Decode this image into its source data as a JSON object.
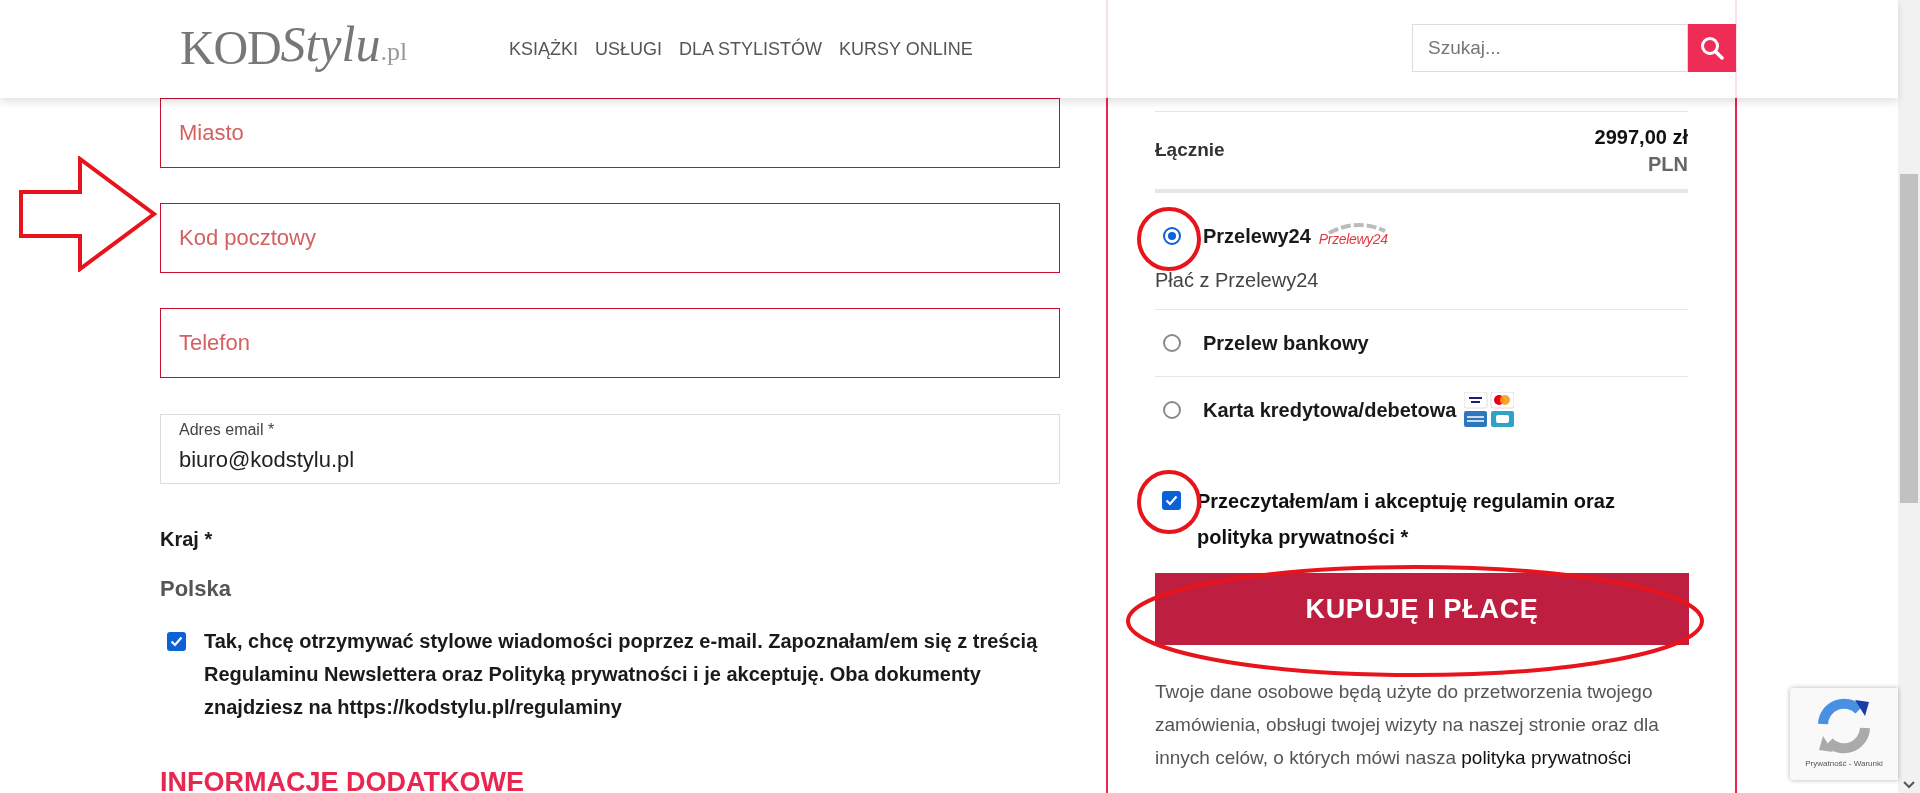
{
  "header": {
    "logo": {
      "main": "KOD",
      "script": "Stylu",
      "suffix": ".pl"
    },
    "nav": [
      "KSIĄŻKI",
      "USŁUGI",
      "DLA STYLISTÓW",
      "KURSY ONLINE"
    ],
    "search": {
      "placeholder": "Szukaj..."
    }
  },
  "form": {
    "fields": [
      {
        "placeholder": "Miasto",
        "invalid": true
      },
      {
        "placeholder": "Kod pocztowy",
        "invalid": true
      },
      {
        "placeholder": "Telefon",
        "invalid": true
      },
      {
        "label": "Adres email *",
        "value": "biuro@kodstylu.pl",
        "invalid": false
      }
    ],
    "country_label": "Kraj *",
    "country_value": "Polska",
    "newsletter": {
      "checked": true,
      "text": "Tak, chcę otrzymywać stylowe wiadomości poprzez e-mail. Zapoznałam/em się z treścią Regulaminu Newslettera oraz Polityką prywatności i je akceptuję. Oba dokumenty znajdziesz na https://kodstylu.pl/regulaminy"
    },
    "section_heading": "INFORMACJE DODATKOWE"
  },
  "order": {
    "total": {
      "label": "Łącznie",
      "value": "2997,00 zł",
      "currency": "PLN"
    },
    "payment_methods": [
      {
        "label": "Przelewy24",
        "selected": true,
        "kind": "p24",
        "logo": "Przelewy24",
        "description": "Płać z Przelewy24"
      },
      {
        "label": "Przelew bankowy",
        "selected": false,
        "kind": "plain"
      },
      {
        "label": "Karta kredytowa/debetowa",
        "selected": false,
        "kind": "cards"
      }
    ],
    "terms": {
      "checked": true,
      "text": "Przeczytałem/am i akceptuję regulamin oraz polityka prywatności *"
    },
    "submit": "KUPUJĘ I PŁACĘ",
    "privacy_note": "Twoje dane osobowe będą użyte do przetworzenia twojego zamówienia, obsługi twojej wizyty na naszej stronie oraz dla innych celów, o których mówi nasza",
    "privacy_link": "polityka prywatności"
  },
  "recaptcha": {
    "text": "Prywatność - Warunki"
  }
}
